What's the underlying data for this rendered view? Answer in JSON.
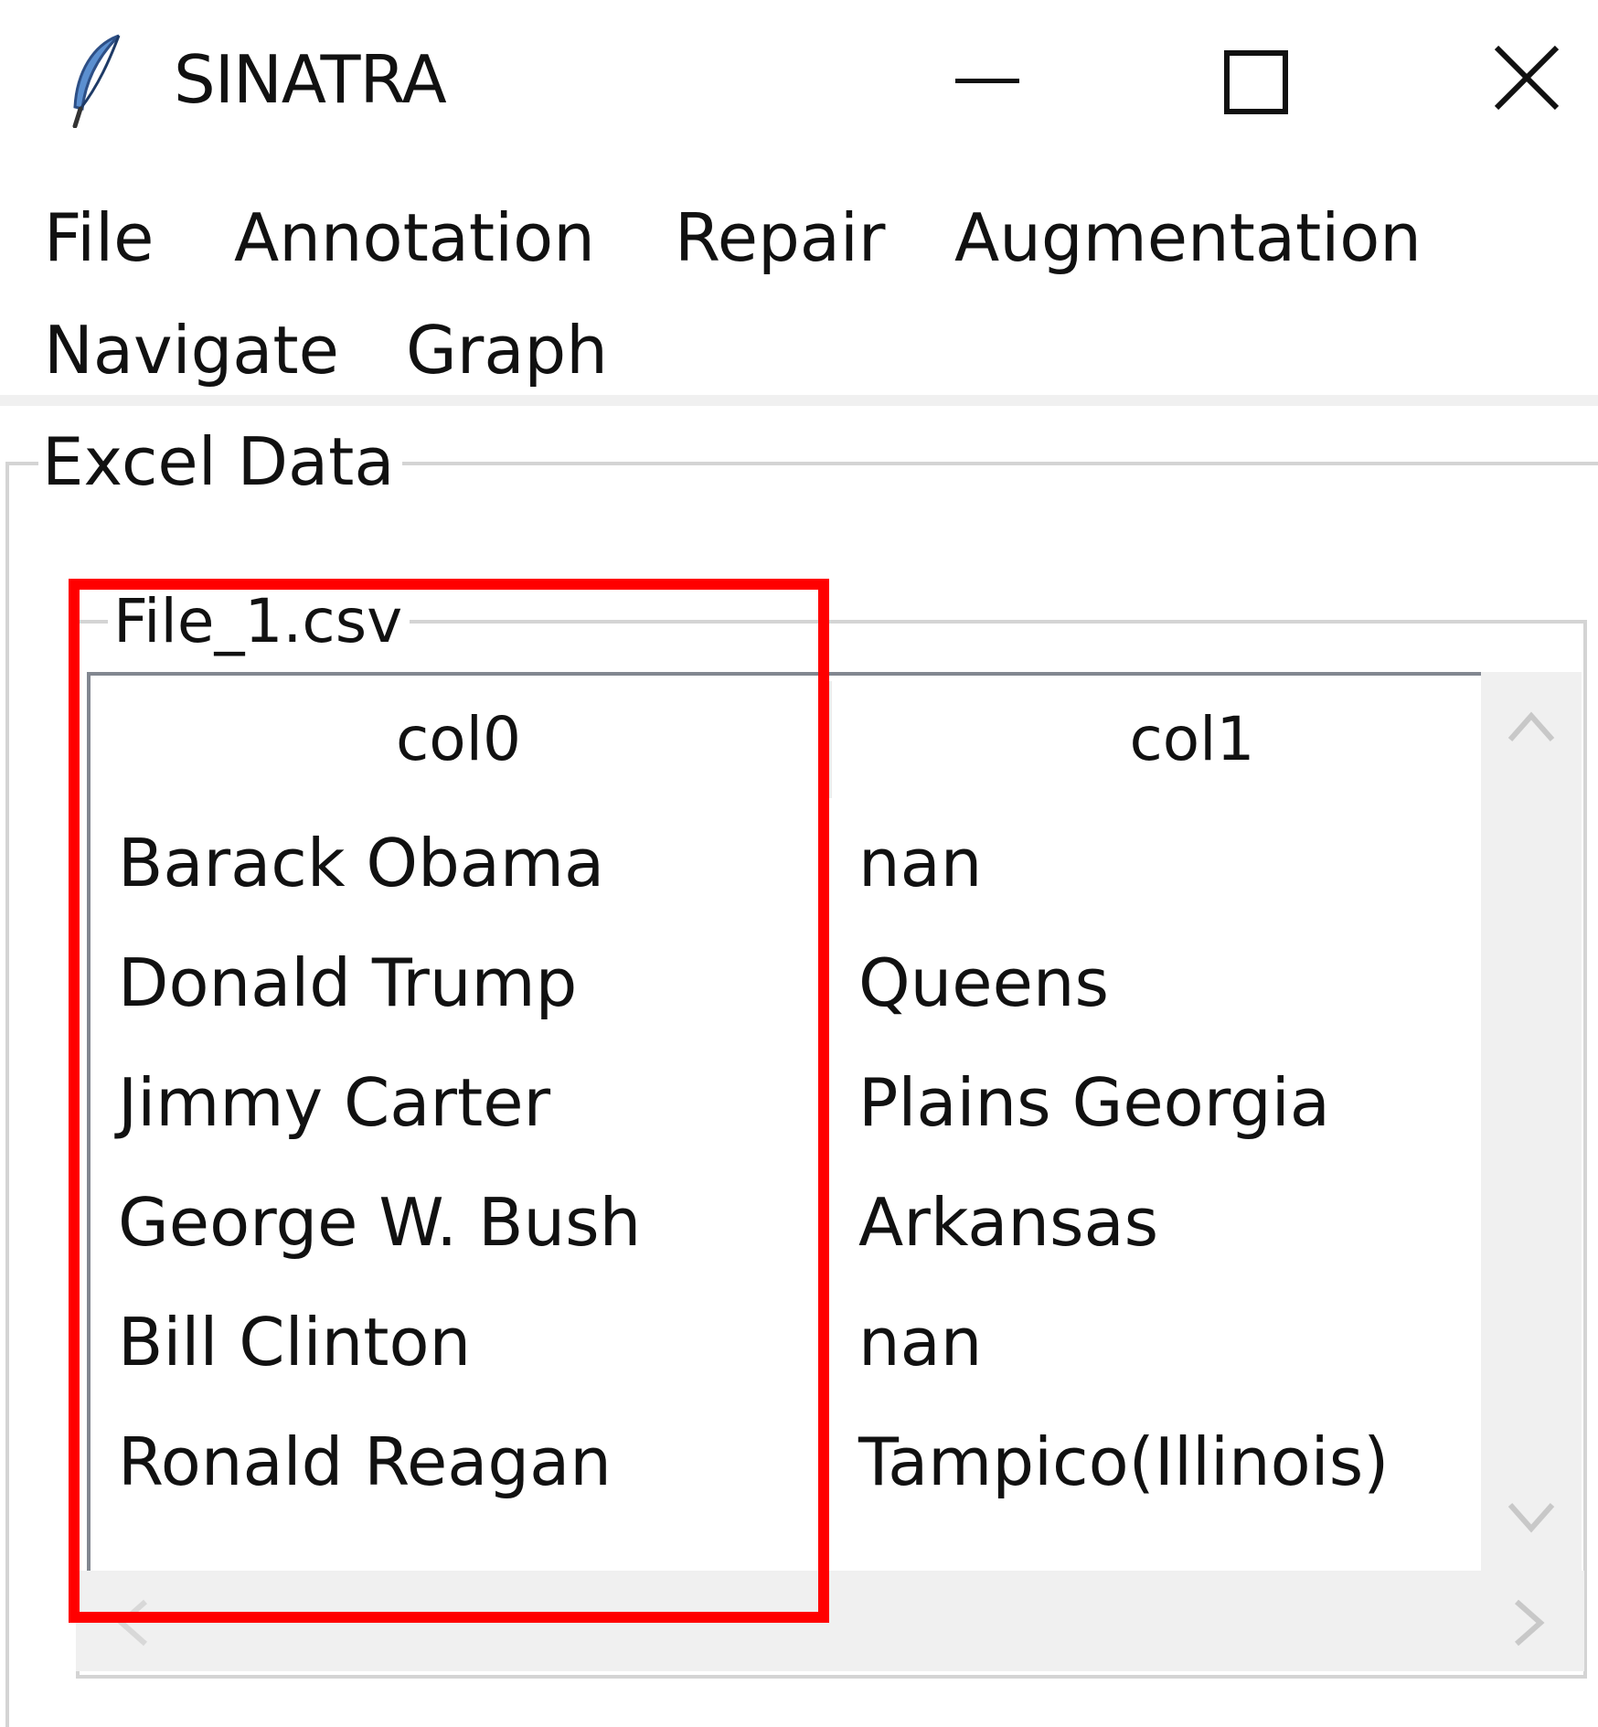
{
  "window": {
    "title": "SINATRA",
    "icon": "feather-icon",
    "controls": [
      "minimize-icon",
      "maximize-icon",
      "close-icon"
    ]
  },
  "menubar": {
    "items": [
      {
        "label": "File"
      },
      {
        "label": "Annotation"
      },
      {
        "label": "Repair"
      },
      {
        "label": "Augmentation"
      },
      {
        "label": "Navigate"
      },
      {
        "label": "Graph"
      }
    ]
  },
  "excel_frame": {
    "label": "Excel Data"
  },
  "file_frame": {
    "label": "File_1.csv"
  },
  "table": {
    "columns": [
      "col0",
      "col1"
    ],
    "rows": [
      [
        "Barack Obama",
        "nan"
      ],
      [
        "Donald Trump",
        "Queens"
      ],
      [
        "Jimmy Carter",
        "Plains Georgia"
      ],
      [
        "George W. Bush",
        "Arkansas"
      ],
      [
        "Bill Clinton",
        "nan"
      ],
      [
        "Ronald Reagan",
        "Tampico(Illinois)"
      ]
    ]
  },
  "colors": {
    "highlight": "#ff0000",
    "frame_border": "#d4d4d4",
    "scrollbar_bg": "#f0f0f0",
    "tree_border": "#828790"
  }
}
